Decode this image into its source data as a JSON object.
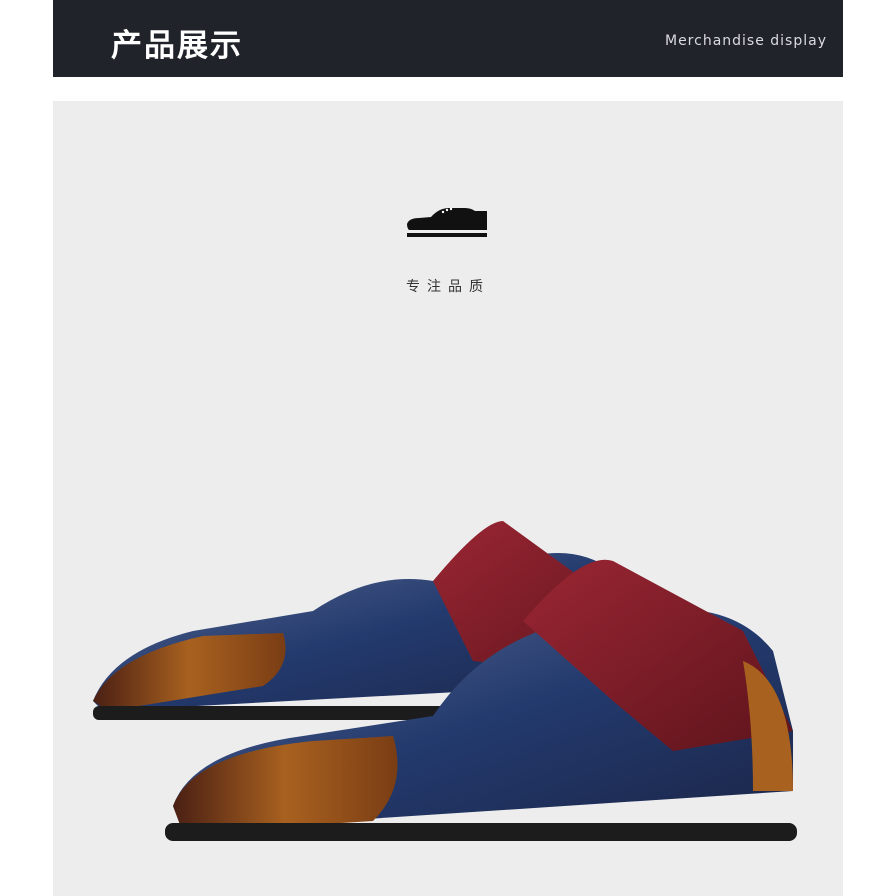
{
  "header": {
    "title": "产品展示",
    "subtitle": "Merchandise display"
  },
  "section": {
    "icon": "oxford-shoe-icon",
    "tagline": "专注品质"
  },
  "product_photo": {
    "subject": "pair-of-brogue-oxford-shoes",
    "colors": {
      "toe": "#8a4a1c",
      "vamp": "#2c3f6a",
      "quarter": "#7e1f2a",
      "sole": "#1c1c1c",
      "background": "#ededee"
    }
  }
}
